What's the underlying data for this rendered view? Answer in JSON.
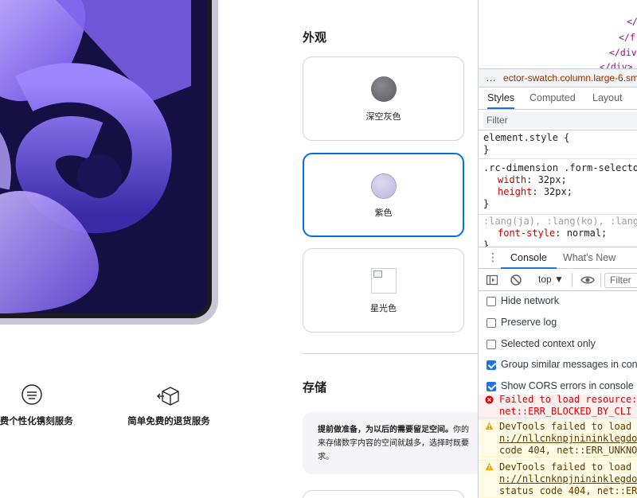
{
  "product": {
    "appearance_title": "外观",
    "swatches": [
      {
        "label": "深空灰色",
        "color": "#6e6d72",
        "selected": false
      },
      {
        "label": "紫色",
        "color": "#cfcbe6",
        "selected": true
      },
      {
        "label": "星光色",
        "color": "",
        "selected": false,
        "broken_image": true
      }
    ],
    "storage_title": "存储",
    "storage_note": {
      "bold": "提前做准备，为以后的需要留足空间。",
      "text_line1": "你的",
      "text_line2": "来存储数字内容的空间就越多，选择时既要",
      "text_line3": "求。"
    },
    "features": [
      {
        "label": "免费个性化镌刻服务",
        "icon": "engraving-icon"
      },
      {
        "label": "简单免费的退货服务",
        "icon": "return-box-icon"
      }
    ]
  },
  "devtools": {
    "dom_lines": [
      "</",
      "</f",
      "</div",
      "</div>"
    ],
    "breadcrumb_more": "…",
    "breadcrumb": "ector-swatch.column.large-6.sm",
    "styles_tabs": [
      "Styles",
      "Computed",
      "Layout"
    ],
    "styles_filter_placeholder": "Filter",
    "rules": [
      {
        "selector": "element.style {",
        "props": [],
        "close": "}"
      },
      {
        "selector": ".rc-dimension .form-selecto",
        "props": [
          {
            "name": "width",
            "value": "32px;"
          },
          {
            "name": "height",
            "value": "32px;"
          }
        ],
        "close": "}"
      },
      {
        "selector": ":lang(ja), :lang(ko), :lang",
        "props": [
          {
            "name": "font-style",
            "value": "normal;"
          }
        ],
        "close": "}"
      }
    ],
    "drawer_tabs": [
      "Console",
      "What's New"
    ],
    "console_context": "top ▼",
    "console_filter_placeholder": "Filter",
    "console_settings": [
      {
        "label": "Hide network",
        "checked": false
      },
      {
        "label": "Preserve log",
        "checked": false
      },
      {
        "label": "Selected context only",
        "checked": false
      },
      {
        "label": "Group similar messages in cons",
        "checked": true
      },
      {
        "label": "Show CORS errors in console",
        "checked": true
      }
    ],
    "messages": [
      {
        "level": "error",
        "line1": "Failed to load resource:",
        "line2": "net::ERR_BLOCKED_BY_CLI"
      },
      {
        "level": "warning",
        "line1": "DevTools failed to load",
        "link": "n://nllcnknpjnininklegdo",
        "line3": "code 404, net::ERR_UNKNO"
      },
      {
        "level": "warning",
        "line1": "DevTools failed to load",
        "link": "n://nllcnknpjnininklegdo",
        "line3": "status code 404, net::ERI"
      }
    ]
  }
}
